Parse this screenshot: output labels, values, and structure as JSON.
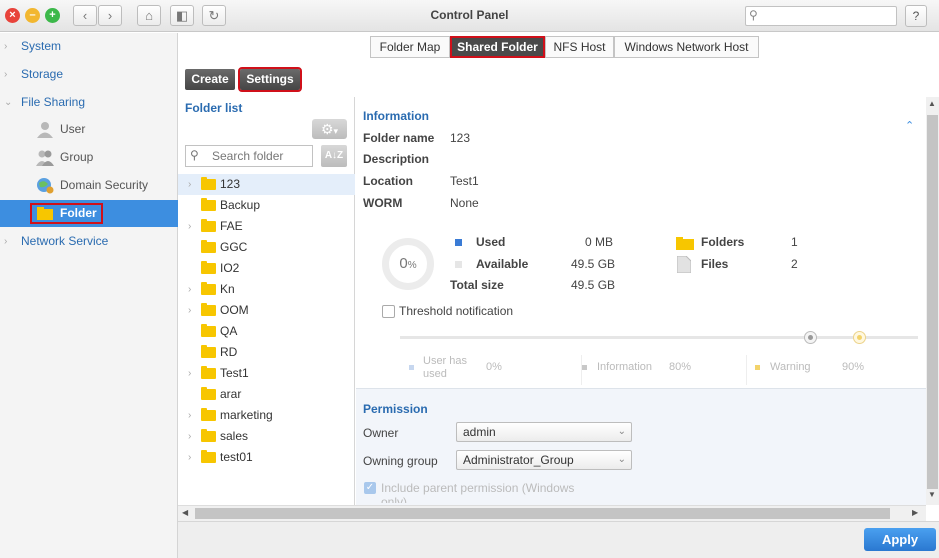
{
  "window": {
    "title": "Control Panel",
    "search_placeholder": ""
  },
  "sidebar": {
    "items": [
      {
        "label": "System"
      },
      {
        "label": "Storage"
      },
      {
        "label": "File Sharing"
      },
      {
        "label": "Network Service"
      }
    ],
    "file_sharing_children": [
      {
        "label": "User"
      },
      {
        "label": "Group"
      },
      {
        "label": "Domain Security"
      },
      {
        "label": "Folder"
      }
    ]
  },
  "tabs": [
    {
      "label": "Folder Map"
    },
    {
      "label": "Shared Folder"
    },
    {
      "label": "NFS Host"
    },
    {
      "label": "Windows Network Host"
    }
  ],
  "toolbar": {
    "create_label": "Create",
    "settings_label": "Settings"
  },
  "folder_list": {
    "header": "Folder list",
    "search_placeholder": "Search folder",
    "sort_label": "A↓Z",
    "items": [
      {
        "name": "123",
        "expandable": true
      },
      {
        "name": "Backup",
        "expandable": false
      },
      {
        "name": "FAE",
        "expandable": true
      },
      {
        "name": "GGC",
        "expandable": false
      },
      {
        "name": "IO2",
        "expandable": false
      },
      {
        "name": "Kn",
        "expandable": true
      },
      {
        "name": "OOM",
        "expandable": true
      },
      {
        "name": "QA",
        "expandable": false
      },
      {
        "name": "RD",
        "expandable": false
      },
      {
        "name": "Test1",
        "expandable": true
      },
      {
        "name": "arar",
        "expandable": false
      },
      {
        "name": "marketing",
        "expandable": true
      },
      {
        "name": "sales",
        "expandable": true
      },
      {
        "name": "test01",
        "expandable": true
      }
    ]
  },
  "info": {
    "section_title": "Information",
    "folder_name_label": "Folder name",
    "folder_name": "123",
    "description_label": "Description",
    "description": "",
    "location_label": "Location",
    "location": "Test1",
    "worm_label": "WORM",
    "worm": "None",
    "usage_percent_text": "0",
    "usage_percent_unit": "%",
    "used_label": "Used",
    "used": "0 MB",
    "available_label": "Available",
    "available": "49.5 GB",
    "total_label": "Total size",
    "total": "49.5 GB",
    "folders_label": "Folders",
    "folders": "1",
    "files_label": "Files",
    "files": "2",
    "threshold_label": "Threshold notification",
    "legend_user_label": "User has used",
    "legend_user_value": "0%",
    "legend_info_label": "Information",
    "legend_info_value": "80%",
    "legend_warn_label": "Warning",
    "legend_warn_value": "90%"
  },
  "permission": {
    "section_title": "Permission",
    "owner_label": "Owner",
    "owner": "admin",
    "group_label": "Owning group",
    "group": "Administrator_Group",
    "include_parent_label": "Include parent permission (Windows only)"
  },
  "footer": {
    "apply_label": "Apply"
  },
  "colors": {
    "accent": "#3d8ee0",
    "highlight": "#d0101a",
    "link": "#2a6bb0"
  }
}
